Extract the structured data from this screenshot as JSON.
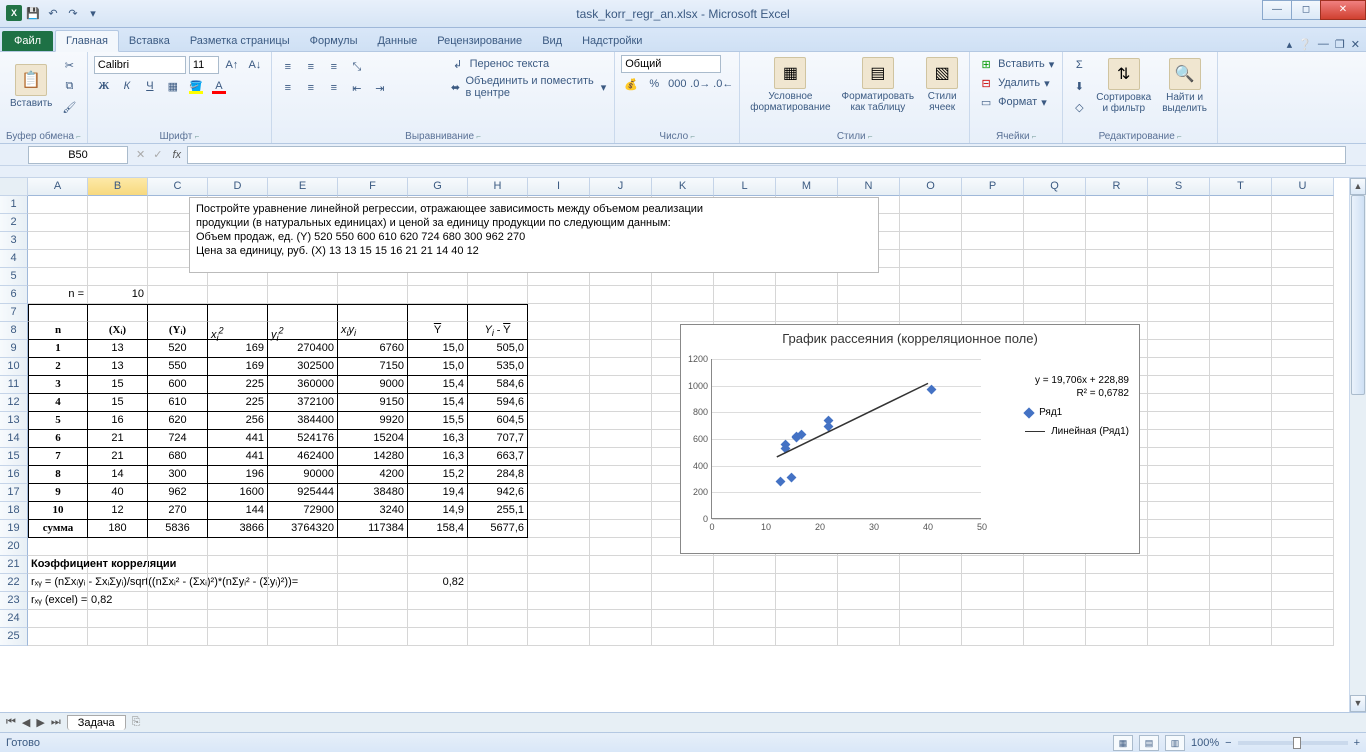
{
  "app_title": "task_korr_regr_an.xlsx - Microsoft Excel",
  "tabs": {
    "file": "Файл",
    "home": "Главная",
    "insert": "Вставка",
    "layout": "Разметка страницы",
    "formulas": "Формулы",
    "data": "Данные",
    "review": "Рецензирование",
    "view": "Вид",
    "addins": "Надстройки"
  },
  "ribbon": {
    "clipboard": {
      "paste": "Вставить",
      "label": "Буфер обмена"
    },
    "font": {
      "name": "Calibri",
      "size": "11",
      "label": "Шрифт",
      "bold": "Ж",
      "italic": "К",
      "underline": "Ч"
    },
    "align": {
      "wrap": "Перенос текста",
      "merge": "Объединить и поместить в центре",
      "label": "Выравнивание"
    },
    "number": {
      "format": "Общий",
      "label": "Число"
    },
    "styles": {
      "cond": "Условное\nформатирование",
      "table": "Форматировать\nкак таблицу",
      "cell": "Стили\nячеек",
      "label": "Стили"
    },
    "cells": {
      "insert": "Вставить",
      "delete": "Удалить",
      "format": "Формат",
      "label": "Ячейки"
    },
    "editing": {
      "sort": "Сортировка\nи фильтр",
      "find": "Найти и\nвыделить",
      "label": "Редактирование"
    }
  },
  "namebox": "B50",
  "columns": [
    "A",
    "B",
    "C",
    "D",
    "E",
    "F",
    "G",
    "H",
    "I",
    "J",
    "K",
    "L",
    "M",
    "N",
    "O",
    "P",
    "Q",
    "R",
    "S",
    "T",
    "U"
  ],
  "instruction": {
    "l1": "Постройте уравнение линейной регрессии, отражающее зависимость между  объемом реализации",
    "l2": "продукции (в натуральных единицах) и ценой за единицу продукции по следующим данным:",
    "l3": "Объем продаж, ед. (Y) 520 550 600 610 620 724 680 300 962 270",
    "l4": "Цена за единицу, руб. (X) 13 13 15 15 16 21 21 14 40 12"
  },
  "n_label": "n =",
  "n_val": "10",
  "headers": {
    "n": "n",
    "xi": "(Xᵢ)",
    "yi": "(Yᵢ)",
    "xi2": "xᵢ²",
    "yi2": "yᵢ²",
    "xiyi": "xᵢyᵢ",
    "ybar": "Y̅",
    "dev": "Yᵢ - Y̅"
  },
  "tbl": [
    {
      "n": "1",
      "xi": "13",
      "yi": "520",
      "xi2": "169",
      "yi2": "270400",
      "xiyi": "6760",
      "yb": "15,0",
      "dev": "505,0"
    },
    {
      "n": "2",
      "xi": "13",
      "yi": "550",
      "xi2": "169",
      "yi2": "302500",
      "xiyi": "7150",
      "yb": "15,0",
      "dev": "535,0"
    },
    {
      "n": "3",
      "xi": "15",
      "yi": "600",
      "xi2": "225",
      "yi2": "360000",
      "xiyi": "9000",
      "yb": "15,4",
      "dev": "584,6"
    },
    {
      "n": "4",
      "xi": "15",
      "yi": "610",
      "xi2": "225",
      "yi2": "372100",
      "xiyi": "9150",
      "yb": "15,4",
      "dev": "594,6"
    },
    {
      "n": "5",
      "xi": "16",
      "yi": "620",
      "xi2": "256",
      "yi2": "384400",
      "xiyi": "9920",
      "yb": "15,5",
      "dev": "604,5"
    },
    {
      "n": "6",
      "xi": "21",
      "yi": "724",
      "xi2": "441",
      "yi2": "524176",
      "xiyi": "15204",
      "yb": "16,3",
      "dev": "707,7"
    },
    {
      "n": "7",
      "xi": "21",
      "yi": "680",
      "xi2": "441",
      "yi2": "462400",
      "xiyi": "14280",
      "yb": "16,3",
      "dev": "663,7"
    },
    {
      "n": "8",
      "xi": "14",
      "yi": "300",
      "xi2": "196",
      "yi2": "90000",
      "xiyi": "4200",
      "yb": "15,2",
      "dev": "284,8"
    },
    {
      "n": "9",
      "xi": "40",
      "yi": "962",
      "xi2": "1600",
      "yi2": "925444",
      "xiyi": "38480",
      "yb": "19,4",
      "dev": "942,6"
    },
    {
      "n": "10",
      "xi": "12",
      "yi": "270",
      "xi2": "144",
      "yi2": "72900",
      "xiyi": "3240",
      "yb": "14,9",
      "dev": "255,1"
    }
  ],
  "sum": {
    "lbl": "сумма",
    "xi": "180",
    "yi": "5836",
    "xi2": "3866",
    "yi2": "3764320",
    "xiyi": "117384",
    "yb": "158,4",
    "dev": "5677,6"
  },
  "corr_title": "Коэффициент корреляции",
  "corr_formula": "rₓᵧ = (nΣxᵢyᵢ - ΣxᵢΣyᵢ)/sqrt((nΣxᵢ² - (Σxᵢ)²)*(nΣyᵢ² - (Σyᵢ)²))=",
  "corr_val": "0,82",
  "corr_excel_lbl": "rₓᵧ (excel) =",
  "corr_excel_val": "0,82",
  "chart": {
    "title": "График рассеяния (корреляционное поле)",
    "eq": "y = 19,706x + 228,89",
    "r2": "R² = 0,6782",
    "legend1": "Ряд1",
    "legend2": "Линейная (Ряд1)"
  },
  "chart_data": {
    "type": "scatter",
    "title": "График рассеяния (корреляционное поле)",
    "xlabel": "",
    "ylabel": "",
    "xlim": [
      0,
      50
    ],
    "ylim": [
      0,
      1200
    ],
    "xticks": [
      0,
      10,
      20,
      30,
      40,
      50
    ],
    "yticks": [
      0,
      200,
      400,
      600,
      800,
      1000,
      1200
    ],
    "series": [
      {
        "name": "Ряд1",
        "type": "scatter",
        "x": [
          13,
          13,
          15,
          15,
          16,
          21,
          21,
          14,
          40,
          12
        ],
        "y": [
          520,
          550,
          600,
          610,
          620,
          724,
          680,
          300,
          962,
          270
        ]
      },
      {
        "name": "Линейная (Ряд1)",
        "type": "line",
        "equation": "y = 19.706x + 228.89",
        "r2": 0.6782,
        "x": [
          12,
          40
        ],
        "y": [
          465.36,
          1017.13
        ]
      }
    ]
  },
  "sheet_tab": "Задача",
  "status_ready": "Готово",
  "zoom": "100%"
}
